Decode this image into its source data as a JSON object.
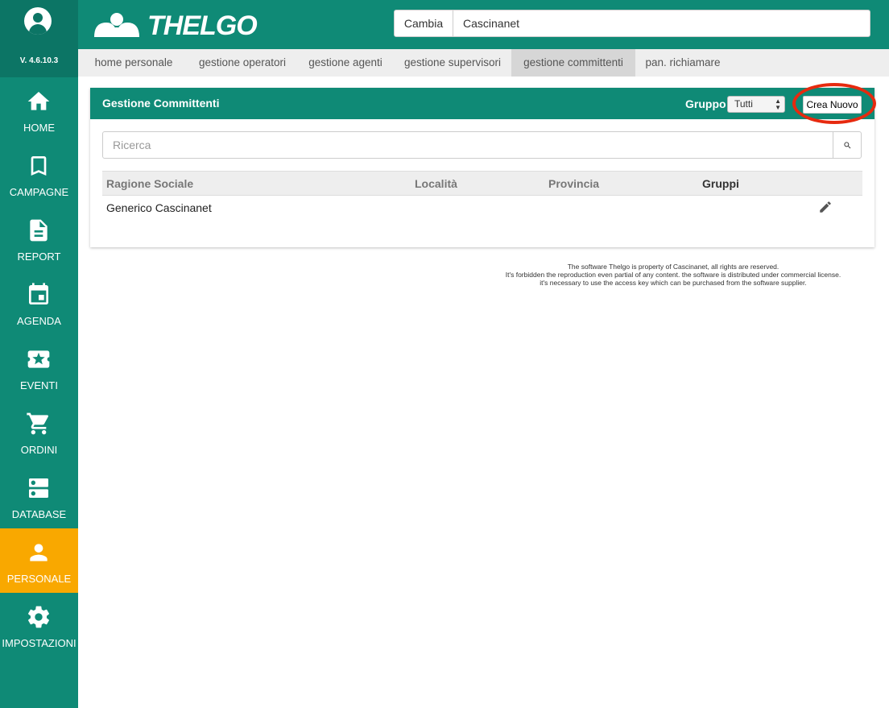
{
  "sidebar": {
    "version": "V. 4.6.10.3",
    "items": [
      {
        "label": "HOME"
      },
      {
        "label": "CAMPAGNE"
      },
      {
        "label": "REPORT"
      },
      {
        "label": "AGENDA"
      },
      {
        "label": "EVENTI"
      },
      {
        "label": "ORDINI"
      },
      {
        "label": "DATABASE"
      },
      {
        "label": "PERSONALE"
      },
      {
        "label": "IMPOSTAZIONI"
      }
    ],
    "active_item": "PERSONALE"
  },
  "header": {
    "logo_text": "THELGO",
    "cambia_label": "Cambia",
    "company_value": "Cascinanet"
  },
  "tabs": [
    {
      "label": "home personale"
    },
    {
      "label": "gestione operatori"
    },
    {
      "label": "gestione agenti"
    },
    {
      "label": "gestione supervisori"
    },
    {
      "label": "gestione committenti"
    },
    {
      "label": "pan. richiamare"
    }
  ],
  "active_tab": "gestione committenti",
  "panel": {
    "title": "Gestione Committenti",
    "gruppo_label": "Gruppo",
    "gruppo_selected": "Tutti",
    "crea_label": "Crea Nuovo",
    "search_placeholder": "Ricerca",
    "columns": [
      "Ragione Sociale",
      "Località",
      "Provincia",
      "Gruppi"
    ],
    "rows": [
      {
        "ragione_sociale": "Generico Cascinanet",
        "localita": "",
        "provincia": "",
        "gruppi": ""
      }
    ]
  },
  "footer": {
    "lines": [
      "The software Thelgo is property of Cascinanet, all rights are reserved.",
      "It's forbidden the reproduction even partial of any content. the software is distributed under commercial license.",
      "it's necessary to use the access key which can be purchased from the software supplier."
    ]
  },
  "colors": {
    "brand_green": "#0f8a76",
    "active_orange": "#f9a800",
    "highlight_red": "#e62a0f"
  }
}
